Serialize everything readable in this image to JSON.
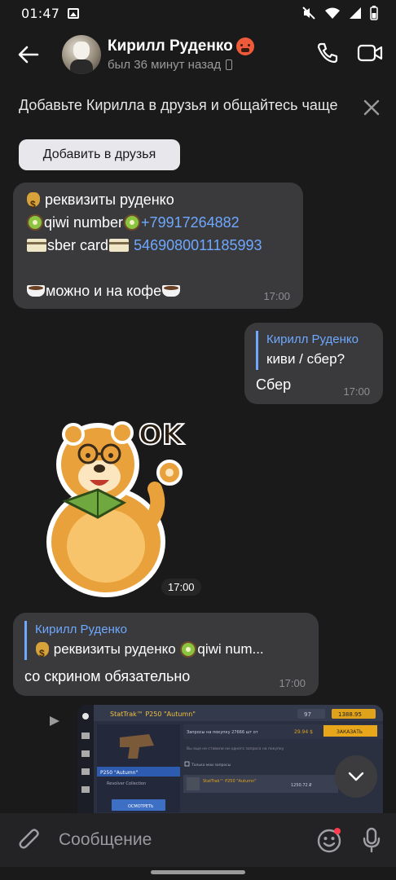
{
  "status_bar": {
    "time": "01:47"
  },
  "header": {
    "contact_name": "Кирилл Руденко",
    "last_seen": "был 36 минут назад"
  },
  "banner": {
    "text": "Добавьте Кирилла в друзья и общайтесь чаще",
    "button": "Добавить в друзья"
  },
  "messages": {
    "m1": {
      "line1": "реквизиты руденко",
      "line2_label": "qiwi number",
      "line2_link": "+79917264882",
      "line3_label": "sber card",
      "line3_link": "5469080011185993",
      "line4": "можно и на кофе",
      "time": "17:00"
    },
    "m2": {
      "reply_author": "Кирилл Руденко",
      "reply_text": "киви / сбер?",
      "text": "Сбер",
      "time": "17:00"
    },
    "m3": {
      "sticker_text": "OK",
      "time": "17:00"
    },
    "m4": {
      "reply_author": "Кирилл Руденко",
      "reply_text": "реквизиты руденко",
      "reply_text_tail": "qiwi num...",
      "text": "со скрином обязательно",
      "time": "17:00"
    },
    "m5": {
      "game_title": "StatTrak™ P250 \"Autumn\"",
      "coins_left": "97",
      "coins_right": "1388.95",
      "request_line": "Запросы на покупку 27666 шт от",
      "request_price": "29.94 $",
      "order_button": "ЗАКАЗАТЬ",
      "empty_note": "Вы еще не ставили ни одного запроса на покупку",
      "checkbox_label": "Только мои запросы",
      "item_name": "StatTrak™ P250 \"Autumn\"",
      "item_price": "1250.72 ₽",
      "list_selected": "P250 \"Autumn\"",
      "list_collection": "Revolver Collection",
      "inspect_button": "ОСМОТРЕТЬ"
    }
  },
  "input": {
    "placeholder": "Сообщение"
  },
  "colors": {
    "link": "#6ea8ff",
    "bubble": "#3a3a3c",
    "background": "#1a1a1a"
  }
}
